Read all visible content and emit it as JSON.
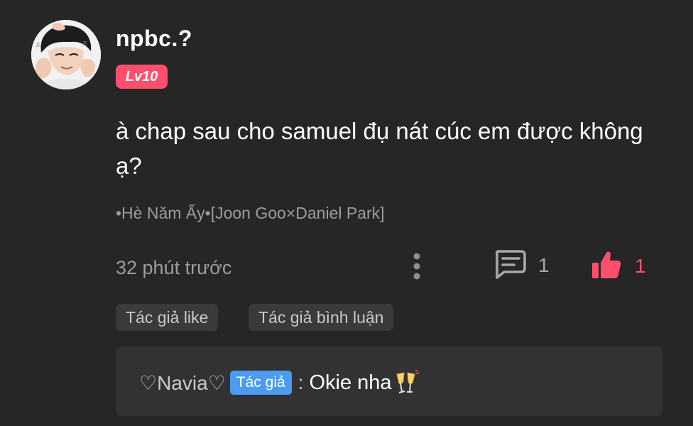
{
  "comment": {
    "username": "npbc.?",
    "level_badge": "Lv10",
    "text": "à chap sau cho samuel đụ nát cúc em được không ạ?",
    "source": "•Hè Năm Ấy•[Joon Goo×Daniel Park]",
    "timestamp": "32 phút trước",
    "reply_count": "1",
    "like_count": "1",
    "icons": {
      "avatar": "avatar",
      "more": "more-vertical-icon",
      "reply": "chat-bubble-icon",
      "like": "thumbs-up-icon"
    }
  },
  "tags": [
    {
      "label": "Tác giả like"
    },
    {
      "label": "Tác giả bình luận"
    }
  ],
  "reply": {
    "author": "♡Navia♡",
    "author_badge": "Tác giả",
    "separator": ":",
    "text": "Okie nha",
    "emoji": "clinking-glasses-icon"
  },
  "colors": {
    "background": "#262627",
    "accent": "#ff4f6d",
    "author_badge": "#4b9cf0",
    "muted_text": "#9c9ca0"
  }
}
